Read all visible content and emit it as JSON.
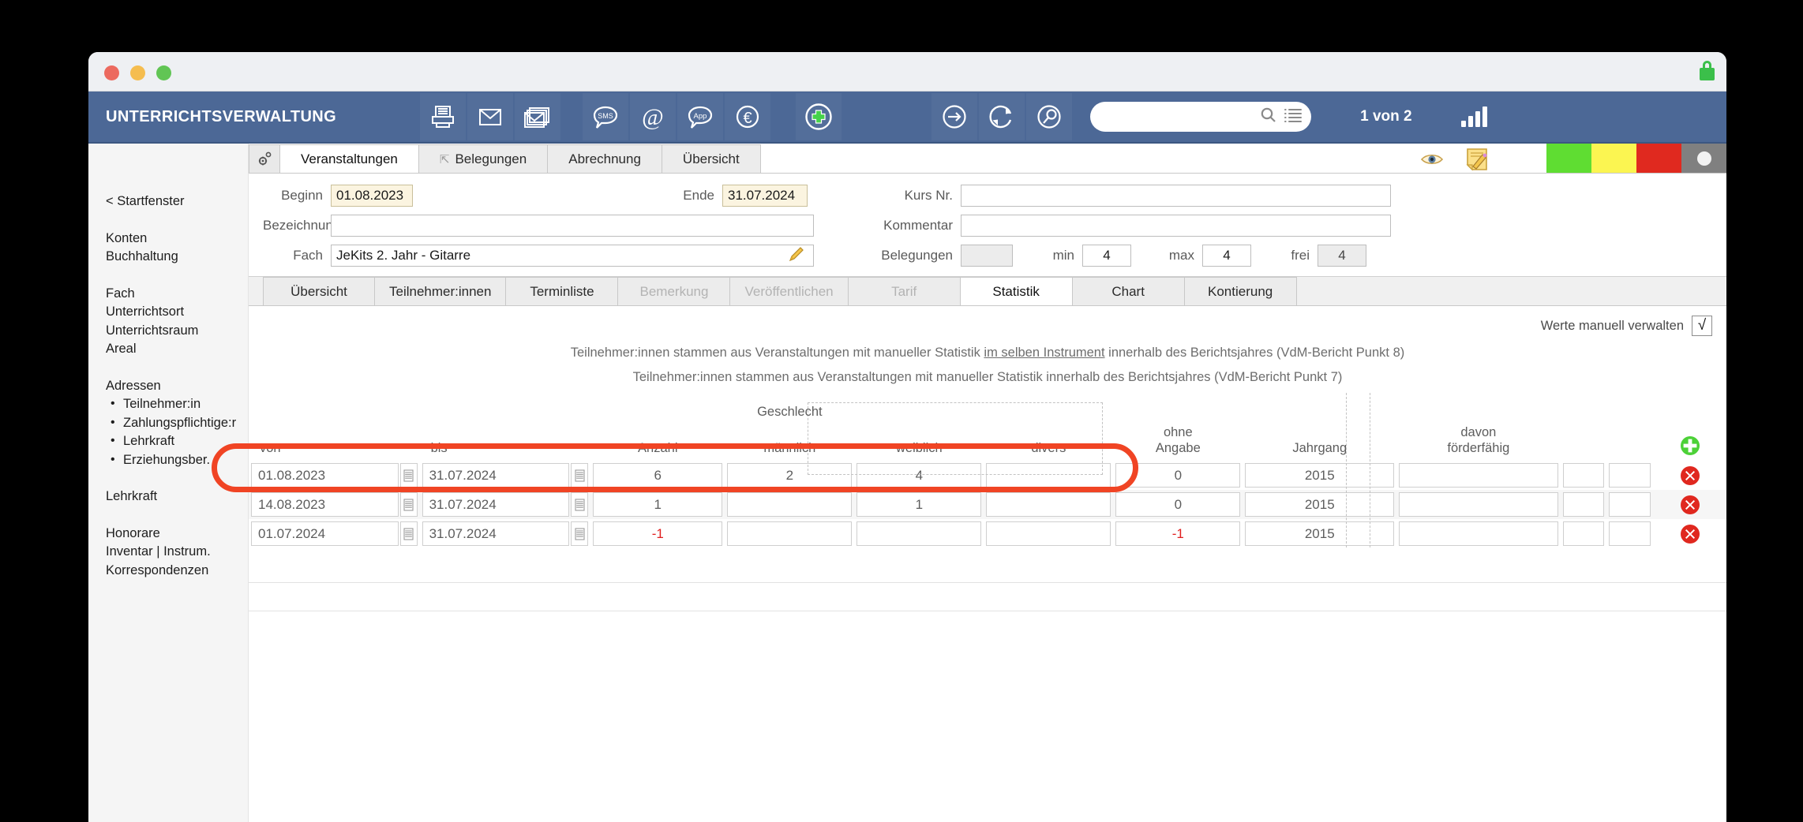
{
  "window": {
    "traffic_lights": [
      "close",
      "minimize",
      "zoom"
    ],
    "lock_icon": "lock-icon"
  },
  "toolbar": {
    "app_title": "UNTERRICHTSVERWALTUNG",
    "icons_left": [
      {
        "name": "printer-icon",
        "label": "Drucken"
      },
      {
        "name": "mail-icon",
        "label": "E-Mail"
      },
      {
        "name": "mail-stack-icon",
        "label": "Serienmail"
      }
    ],
    "icons_mid": [
      {
        "name": "sms-bubble-icon",
        "label": "SMS"
      },
      {
        "name": "at-sign-icon",
        "label": "@"
      },
      {
        "name": "app-bubble-icon",
        "label": "App"
      },
      {
        "name": "euro-circle-icon",
        "label": "€"
      }
    ],
    "icons_plus": [
      {
        "name": "plus-circle-icon",
        "label": "Neu"
      }
    ],
    "icons_right": [
      {
        "name": "arrow-right-circle-icon",
        "label": "Gehe zu"
      },
      {
        "name": "refresh-circle-icon",
        "label": "Aktualisieren"
      },
      {
        "name": "search-circle-icon",
        "label": "Suchen"
      }
    ],
    "search": {
      "value": "",
      "placeholder": ""
    },
    "search_icon": "magnifier-icon",
    "list_icon": "list-icon",
    "pager": "1 von 2",
    "signal_icon": "signal-bars-icon"
  },
  "sidebar": {
    "back_label": "< Startfenster",
    "groups": [
      {
        "items": [
          {
            "label": "Konten",
            "sub": false
          },
          {
            "label": "Buchhaltung",
            "sub": false
          }
        ]
      },
      {
        "items": [
          {
            "label": "Fach",
            "sub": false
          },
          {
            "label": "Unterrichtsort",
            "sub": false
          },
          {
            "label": "Unterrichtsraum",
            "sub": false
          },
          {
            "label": "Areal",
            "sub": false
          }
        ]
      },
      {
        "items": [
          {
            "label": "Adressen",
            "sub": false
          },
          {
            "label": "Teilnehmer:in",
            "sub": true
          },
          {
            "label": "Zahlungspflichtige:r",
            "sub": true
          },
          {
            "label": "Lehrkraft",
            "sub": true
          },
          {
            "label": "Erziehungsber.",
            "sub": true
          }
        ]
      },
      {
        "items": [
          {
            "label": "Lehrkraft",
            "sub": false
          }
        ]
      },
      {
        "items": [
          {
            "label": "Honorare",
            "sub": false
          },
          {
            "label": "Inventar | Instrum.",
            "sub": false
          },
          {
            "label": "Korrespondenzen",
            "sub": false
          }
        ]
      }
    ]
  },
  "tabs_primary": {
    "gear_icon": "gear-icon",
    "items": [
      {
        "label": "Veranstaltungen",
        "active": true,
        "hook": false
      },
      {
        "label": "Belegungen",
        "active": false,
        "hook": true
      },
      {
        "label": "Abrechnung",
        "active": false,
        "hook": false
      },
      {
        "label": "Übersicht",
        "active": false,
        "hook": false
      }
    ],
    "eye_icon": "eye-icon",
    "edit_note_icon": "note-pencil-icon",
    "status_swatches": [
      {
        "name": "status-green",
        "color": "#5fdd32"
      },
      {
        "name": "status-yellow",
        "color": "#fbf551"
      },
      {
        "name": "status-red",
        "color": "#e0291f"
      },
      {
        "name": "status-grey",
        "color": "#808080"
      }
    ]
  },
  "form": {
    "beginn_label": "Beginn",
    "beginn_value": "01.08.2023",
    "ende_label": "Ende",
    "ende_value": "31.07.2024",
    "bezeichnung_label": "Bezeichnung",
    "bezeichnung_value": "",
    "fach_label": "Fach",
    "fach_value": "JeKits 2. Jahr - Gitarre",
    "fach_pencil_icon": "pencil-icon",
    "kursnr_label": "Kurs Nr.",
    "kursnr_value": "",
    "kommentar_label": "Kommentar",
    "kommentar_value": "",
    "belegungen_label": "Belegungen",
    "belegungen_value": "",
    "min_label": "min",
    "min_value": "4",
    "max_label": "max",
    "max_value": "4",
    "frei_label": "frei",
    "frei_value": "4"
  },
  "tabs_secondary": {
    "items": [
      {
        "label": "Übersicht",
        "active": false,
        "disabled": false
      },
      {
        "label": "Teilnehmer:innen",
        "active": false,
        "disabled": false
      },
      {
        "label": "Terminliste",
        "active": false,
        "disabled": false
      },
      {
        "label": "Bemerkung",
        "active": false,
        "disabled": true
      },
      {
        "label": "Veröffentlichen",
        "active": false,
        "disabled": true
      },
      {
        "label": "Tarif",
        "active": false,
        "disabled": true
      },
      {
        "label": "Statistik",
        "active": true,
        "disabled": false
      },
      {
        "label": "Chart",
        "active": false,
        "disabled": false
      },
      {
        "label": "Kontierung",
        "active": false,
        "disabled": false
      }
    ]
  },
  "statistik": {
    "manual_label": "Werte manuell verwalten",
    "manual_checked": true,
    "manual_check_glyph": "√",
    "note_1_pre": "Teilnehmer:innen stammen aus Veranstaltungen mit manueller Statistik ",
    "note_1_underline": "im selben Instrument",
    "note_1_post": " innerhalb des Berichtsjahres (VdM-Bericht Punkt 8)",
    "note_2": "Teilnehmer:innen stammen aus Veranstaltungen mit manueller Statistik innerhalb des Berichtsjahres (VdM-Bericht Punkt 7)",
    "group_header_geschlecht": "Geschlecht",
    "columns": [
      {
        "key": "von",
        "label": "von"
      },
      {
        "key": "bis",
        "label": "bis"
      },
      {
        "key": "anzahl",
        "label": "Anzahl"
      },
      {
        "key": "maennlich",
        "label": "männlich"
      },
      {
        "key": "weiblich",
        "label": "weiblich"
      },
      {
        "key": "divers",
        "label": "divers"
      },
      {
        "key": "ohne",
        "label": "ohne\nAngabe"
      },
      {
        "key": "jahrgang",
        "label": "Jahrgang"
      },
      {
        "key": "davon",
        "label": "davon\nförderfähig"
      }
    ],
    "col_ohne_line1": "ohne",
    "col_ohne_line2": "Angabe",
    "col_davon_line1": "davon",
    "col_davon_line2": "förderfähig",
    "add_row_icon": "add-circle-icon",
    "delete_row_icon": "delete-circle-icon",
    "calendar_icon": "calendar-icon",
    "rows": [
      {
        "von": "01.08.2023",
        "bis": "31.07.2024",
        "anzahl": "6",
        "maennlich": "2",
        "weiblich": "4",
        "divers": "",
        "ohne": "0",
        "jahrgang": "2015",
        "davon": "",
        "extra1": "",
        "extra2": "",
        "negative": false
      },
      {
        "von": "14.08.2023",
        "bis": "31.07.2024",
        "anzahl": "1",
        "maennlich": "",
        "weiblich": "1",
        "divers": "",
        "ohne": "0",
        "jahrgang": "2015",
        "davon": "",
        "extra1": "",
        "extra2": "",
        "negative": false
      },
      {
        "von": "01.07.2024",
        "bis": "31.07.2024",
        "anzahl": "-1",
        "maennlich": "",
        "weiblich": "",
        "divers": "",
        "ohne": "-1",
        "jahrgang": "2015",
        "davon": "",
        "extra1": "",
        "extra2": "",
        "negative": true
      }
    ]
  },
  "annotation": {
    "highlight_color": "#f04424",
    "highlight_shape": "rounded-rect-outline"
  }
}
